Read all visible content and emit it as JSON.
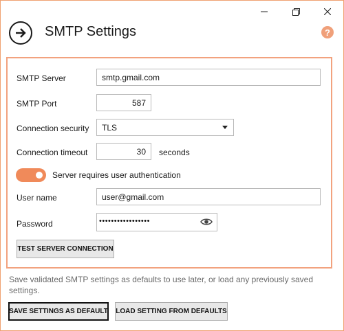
{
  "header": {
    "title": "SMTP Settings",
    "help_glyph": "?"
  },
  "icons": {
    "back": "arrow-right-icon",
    "help": "help-icon",
    "password_reveal": "eye-icon"
  },
  "colors": {
    "accent": "#f08a5a",
    "panel_border": "#f2a27e",
    "help": "#f0a07a"
  },
  "form": {
    "smtp_server": {
      "label": "SMTP Server",
      "value": "smtp.gmail.com"
    },
    "smtp_port": {
      "label": "SMTP Port",
      "value": "587"
    },
    "connection_security": {
      "label": "Connection security",
      "value": "TLS"
    },
    "connection_timeout": {
      "label": "Connection timeout",
      "value": "30",
      "unit": "seconds"
    },
    "auth_toggle": {
      "label": "Server requires user authentication",
      "on": true
    },
    "user_name": {
      "label": "User name",
      "value": "user@gmail.com"
    },
    "password": {
      "label": "Password",
      "masked_value": "•••••••••••••••••"
    },
    "test_button": "TEST SERVER CONNECTION"
  },
  "footer": {
    "info": "Save validated SMTP settings as defaults to use later, or load any previously saved settings.",
    "save_button": "SAVE SETTINGS AS DEFAULT",
    "load_button": "LOAD SETTING FROM DEFAULTS"
  }
}
